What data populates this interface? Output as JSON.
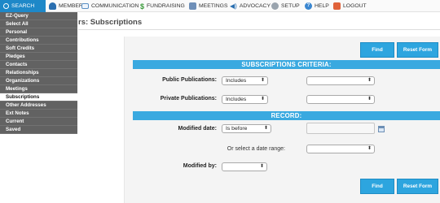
{
  "nav": {
    "tabs": [
      {
        "label": "Search",
        "icon": "search-icon"
      },
      {
        "label": "Members",
        "icon": "members-icon"
      },
      {
        "label": "Communication",
        "icon": "communication-icon"
      },
      {
        "label": "Fundraising",
        "icon": "fundraising-icon"
      },
      {
        "label": "Meetings",
        "icon": "meetings-icon"
      },
      {
        "label": "Advocacy",
        "icon": "advocacy-icon"
      },
      {
        "label": "Setup",
        "icon": "setup-icon"
      },
      {
        "label": "Help",
        "icon": "help-icon"
      },
      {
        "label": "Logout",
        "icon": "logout-icon"
      }
    ]
  },
  "page": {
    "title": "rs: Subscriptions"
  },
  "menu": {
    "items": [
      "EZ-Query",
      "Select All",
      "Personal",
      "Contributions",
      "Soft Credits",
      "Pledges",
      "Contacts",
      "Relationships",
      "Organizations",
      "Meetings",
      "Subscriptions",
      "Other Addresses",
      "Ext Notes",
      "Current",
      "Saved"
    ],
    "active": "Subscriptions"
  },
  "buttons": {
    "find": "Find",
    "reset": "Reset Form"
  },
  "criteria": {
    "header": "SUBSCRIPTIONS CRITERIA:",
    "public_label": "Public Publications:",
    "public_op": "Includes",
    "public_value": "",
    "private_label": "Private Publications:",
    "private_op": "Includes",
    "private_value": ""
  },
  "record": {
    "header": "RECORD:",
    "modified_date_label": "Modified date:",
    "modified_date_op": "Is before",
    "modified_date_value": "",
    "date_range_label": "Or select a date range:",
    "date_range_value": "",
    "modified_by_label": "Modified by:",
    "modified_by_value": ""
  },
  "colors": {
    "accent": "#2da5df",
    "menu_bg": "#626262",
    "nav_active": "#1e88c8"
  }
}
